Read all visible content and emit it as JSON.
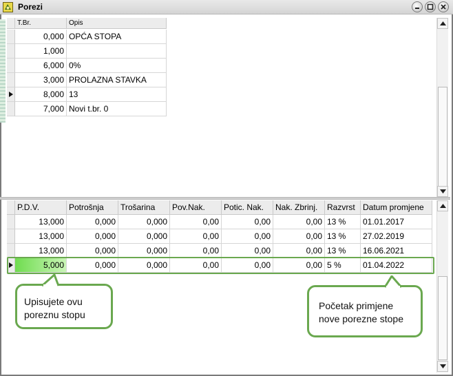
{
  "window": {
    "title": "Porezi",
    "icons": [
      "app-icon",
      "minimize-icon",
      "maximize-icon",
      "close-icon"
    ]
  },
  "top_grid": {
    "columns": [
      "T.Br.",
      "Opis"
    ],
    "rows": [
      {
        "tbr": "0,000",
        "opis": "OPĆA STOPA",
        "selected": false
      },
      {
        "tbr": "1,000",
        "opis": "",
        "selected": false
      },
      {
        "tbr": "6,000",
        "opis": "0%",
        "selected": false
      },
      {
        "tbr": "3,000",
        "opis": "PROLAZNA STAVKA",
        "selected": false
      },
      {
        "tbr": "8,000",
        "opis": "13",
        "selected": true
      },
      {
        "tbr": "7,000",
        "opis": "Novi t.br. 0",
        "selected": false
      }
    ]
  },
  "bottom_grid": {
    "columns": [
      "P.D.V.",
      "Potrošnja",
      "Trošarina",
      "Pov.Nak.",
      "Potic. Nak.",
      "Nak. Zbrinj.",
      "Razvrst",
      "Datum promjene"
    ],
    "rows": [
      {
        "cells": [
          "13,000",
          "0,000",
          "0,000",
          "0,00",
          "0,00",
          "0,00",
          "13 %",
          "01.01.2017"
        ],
        "selected": false
      },
      {
        "cells": [
          "13,000",
          "0,000",
          "0,000",
          "0,00",
          "0,00",
          "0,00",
          "13 %",
          "27.02.2019"
        ],
        "selected": false
      },
      {
        "cells": [
          "13,000",
          "0,000",
          "0,000",
          "0,00",
          "0,00",
          "0,00",
          "13 %",
          "16.06.2021"
        ],
        "selected": false
      },
      {
        "cells": [
          "5,000",
          "0,000",
          "0,000",
          "0,00",
          "0,00",
          "0,00",
          "5 %",
          "01.04.2022"
        ],
        "selected": true
      }
    ]
  },
  "callouts": {
    "left": {
      "line1": "Upisujete ovu",
      "line2": "poreznu stopu"
    },
    "right": {
      "line1": "Početak primjene",
      "line2": "nove porezne stope"
    }
  },
  "colors": {
    "highlight": "#6aa84f",
    "active_cell": "#6fdc4f"
  }
}
